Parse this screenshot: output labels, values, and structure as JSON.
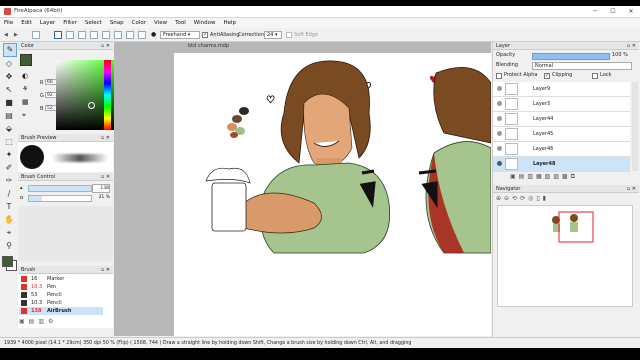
{
  "window": {
    "title": "FireAlpaca (64bit)",
    "minimize": "─",
    "maximize": "☐",
    "close": "✕"
  },
  "menu": [
    "File",
    "Edit",
    "Layer",
    "Filter",
    "Select",
    "Snap",
    "Color",
    "View",
    "Tool",
    "Window",
    "Help"
  ],
  "tool_options": {
    "mode": "Freehand",
    "antialias_label": "AntiAliasing",
    "correction_label": "Correction",
    "correction_value": "24",
    "softedge_label": "Soft Edge"
  },
  "color_panel": {
    "title": "Color",
    "r": "66",
    "g": "92",
    "b": "52",
    "r_label": "R",
    "g_label": "G",
    "b_label": "B"
  },
  "brush_preview": {
    "title": "Brush Preview"
  },
  "brush_control": {
    "title": "Brush Control",
    "size": "138",
    "opacity": "21 %"
  },
  "brush_panel": {
    "title": "Brush",
    "items": [
      {
        "size": "16",
        "name": "Marker",
        "color": "#e03030"
      },
      {
        "size": "16.3",
        "name": "Pen",
        "color": "#e03030"
      },
      {
        "size": "53",
        "name": "Pencil",
        "color": "#333333"
      },
      {
        "size": "10.3",
        "name": "Pencil",
        "color": "#333333"
      },
      {
        "size": "138",
        "name": "AirBrush",
        "color": "#e03030"
      }
    ]
  },
  "document": {
    "tab": "btd charms.mdp"
  },
  "layer_panel": {
    "title": "Layer",
    "opacity_label": "Opacity",
    "opacity_value": "100 %",
    "blending_label": "Blending",
    "blending_value": "Normal",
    "protect_alpha": "Protect Alpha",
    "clipping": "Clipping",
    "lock": "Lock",
    "layers": [
      "Layer9",
      "Layer3",
      "Layer44",
      "Layer45",
      "Layer46",
      "Layer48"
    ]
  },
  "navigator": {
    "title": "Navigator"
  },
  "status": "1939 * 4000 pixel  (14.1 * 29cm)  350 dpi  50 %  (Flip)  ( 1508, 744 )  Draw a straight line by holding down Shift, Change a brush size by holding down Ctrl, Alt, and dragging"
}
